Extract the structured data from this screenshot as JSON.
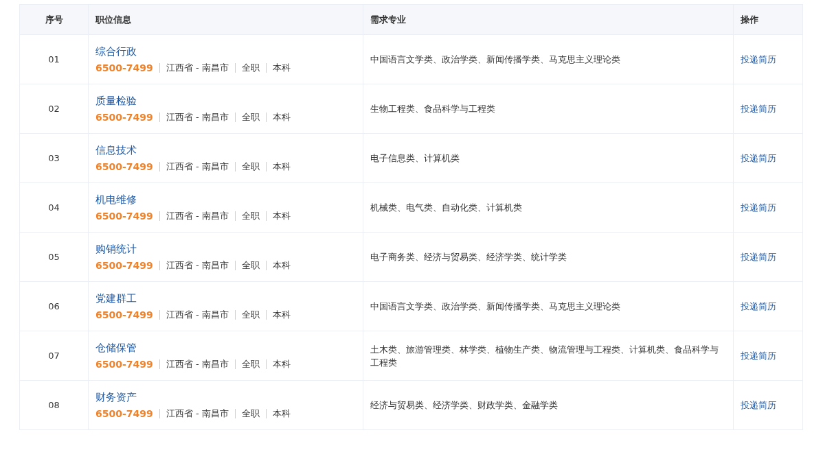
{
  "table": {
    "columns": [
      "序号",
      "职位信息",
      "需求专业",
      "操作"
    ],
    "rows": [
      {
        "index": "01",
        "title": "综合行政",
        "salary": "6500-7499",
        "location": "江西省 - 南昌市",
        "type": "全职",
        "education": "本科",
        "majors": "中国语言文学类、政治学类、新闻传播学类、马克思主义理论类",
        "action": "投递简历"
      },
      {
        "index": "02",
        "title": "质量检验",
        "salary": "6500-7499",
        "location": "江西省 - 南昌市",
        "type": "全职",
        "education": "本科",
        "majors": "生物工程类、食品科学与工程类",
        "action": "投递简历"
      },
      {
        "index": "03",
        "title": "信息技术",
        "salary": "6500-7499",
        "location": "江西省 - 南昌市",
        "type": "全职",
        "education": "本科",
        "majors": "电子信息类、计算机类",
        "action": "投递简历"
      },
      {
        "index": "04",
        "title": "机电维修",
        "salary": "6500-7499",
        "location": "江西省 - 南昌市",
        "type": "全职",
        "education": "本科",
        "majors": "机械类、电气类、自动化类、计算机类",
        "action": "投递简历"
      },
      {
        "index": "05",
        "title": "购销统计",
        "salary": "6500-7499",
        "location": "江西省 - 南昌市",
        "type": "全职",
        "education": "本科",
        "majors": "电子商务类、经济与贸易类、经济学类、统计学类",
        "action": "投递简历"
      },
      {
        "index": "06",
        "title": "党建群工",
        "salary": "6500-7499",
        "location": "江西省 - 南昌市",
        "type": "全职",
        "education": "本科",
        "majors": "中国语言文学类、政治学类、新闻传播学类、马克思主义理论类",
        "action": "投递简历"
      },
      {
        "index": "07",
        "title": "仓储保管",
        "salary": "6500-7499",
        "location": "江西省 - 南昌市",
        "type": "全职",
        "education": "本科",
        "majors": "土木类、旅游管理类、林学类、植物生产类、物流管理与工程类、计算机类、食品科学与工程类",
        "action": "投递简历"
      },
      {
        "index": "08",
        "title": "财务资产",
        "salary": "6500-7499",
        "location": "江西省 - 南昌市",
        "type": "全职",
        "education": "本科",
        "majors": "经济与贸易类、经济学类、财政学类、金融学类",
        "action": "投递简历"
      }
    ]
  }
}
